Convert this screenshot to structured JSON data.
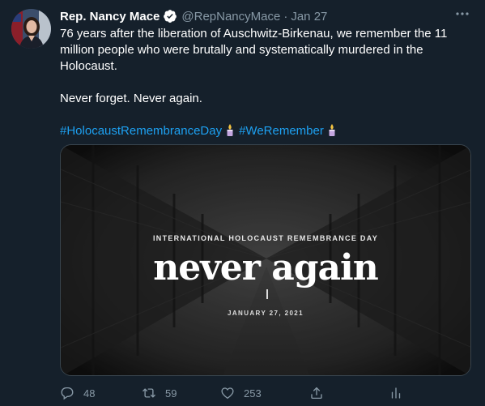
{
  "tweet": {
    "author_name": "Rep. Nancy Mace",
    "handle": "@RepNancyMace",
    "separator": "·",
    "date": "Jan 27",
    "paragraph1": "76 years after the liberation of Auschwitz-Birkenau, we remember the 11 million people who were brutally and systematically murdered in the Holocaust.",
    "paragraph2": "Never forget. Never again.",
    "hashtag1": "#HolocaustRemembranceDay",
    "hashtag2": "#WeRemember"
  },
  "media": {
    "kicker": "INTERNATIONAL HOLOCAUST REMEMBRANCE DAY",
    "headline": "never again",
    "date": "JANUARY 27, 2021"
  },
  "actions": {
    "reply_count": "48",
    "retweet_count": "59",
    "like_count": "253"
  },
  "colors": {
    "background": "#15202b",
    "secondary_text": "#8899a6",
    "link": "#1da1f2",
    "verified": "#ffffff"
  },
  "icons": [
    "verified-badge-icon",
    "more-options-icon",
    "candle-icon",
    "reply-icon",
    "retweet-icon",
    "like-icon",
    "share-icon",
    "analytics-icon"
  ]
}
